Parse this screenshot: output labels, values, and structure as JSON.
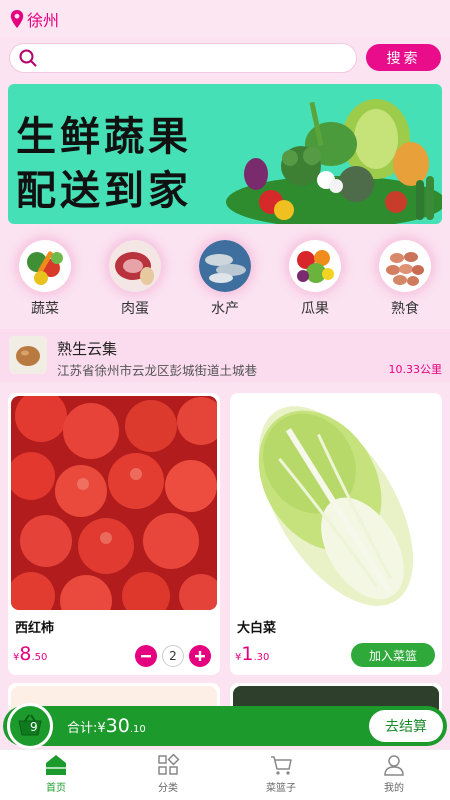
{
  "header": {
    "city": "徐州"
  },
  "search": {
    "placeholder": "",
    "button": "搜索"
  },
  "banner": {
    "line1": "生鲜蔬果",
    "line2": "配送到家"
  },
  "categories": [
    {
      "label": "蔬菜",
      "icon": "vegetables-icon"
    },
    {
      "label": "肉蛋",
      "icon": "meat-egg-icon"
    },
    {
      "label": "水产",
      "icon": "seafood-icon"
    },
    {
      "label": "瓜果",
      "icon": "fruit-icon"
    },
    {
      "label": "熟食",
      "icon": "deli-icon"
    }
  ],
  "store": {
    "name": "熟生云集",
    "address": "江苏省徐州市云龙区彭城街道土城巷",
    "distance": "10.33公里"
  },
  "products": [
    {
      "name": "西红柿",
      "currency": "¥",
      "price_int": "8",
      "price_dec": ".50",
      "quantity": "2"
    },
    {
      "name": "大白菜",
      "currency": "¥",
      "price_int": "1",
      "price_dec": ".30",
      "add_label": "加入菜篮"
    }
  ],
  "cart": {
    "count": "9",
    "total_label": "合计:¥",
    "total_int": "30",
    "total_dec": ".10",
    "checkout": "去结算"
  },
  "tabs": [
    {
      "label": "首页",
      "active": true
    },
    {
      "label": "分类"
    },
    {
      "label": "菜篮子"
    },
    {
      "label": "我的"
    }
  ],
  "colors": {
    "accent": "#e4007f",
    "green": "#1c9b2c",
    "banner_bg": "#46e0b7",
    "page_bg": "#fbe3f1"
  }
}
